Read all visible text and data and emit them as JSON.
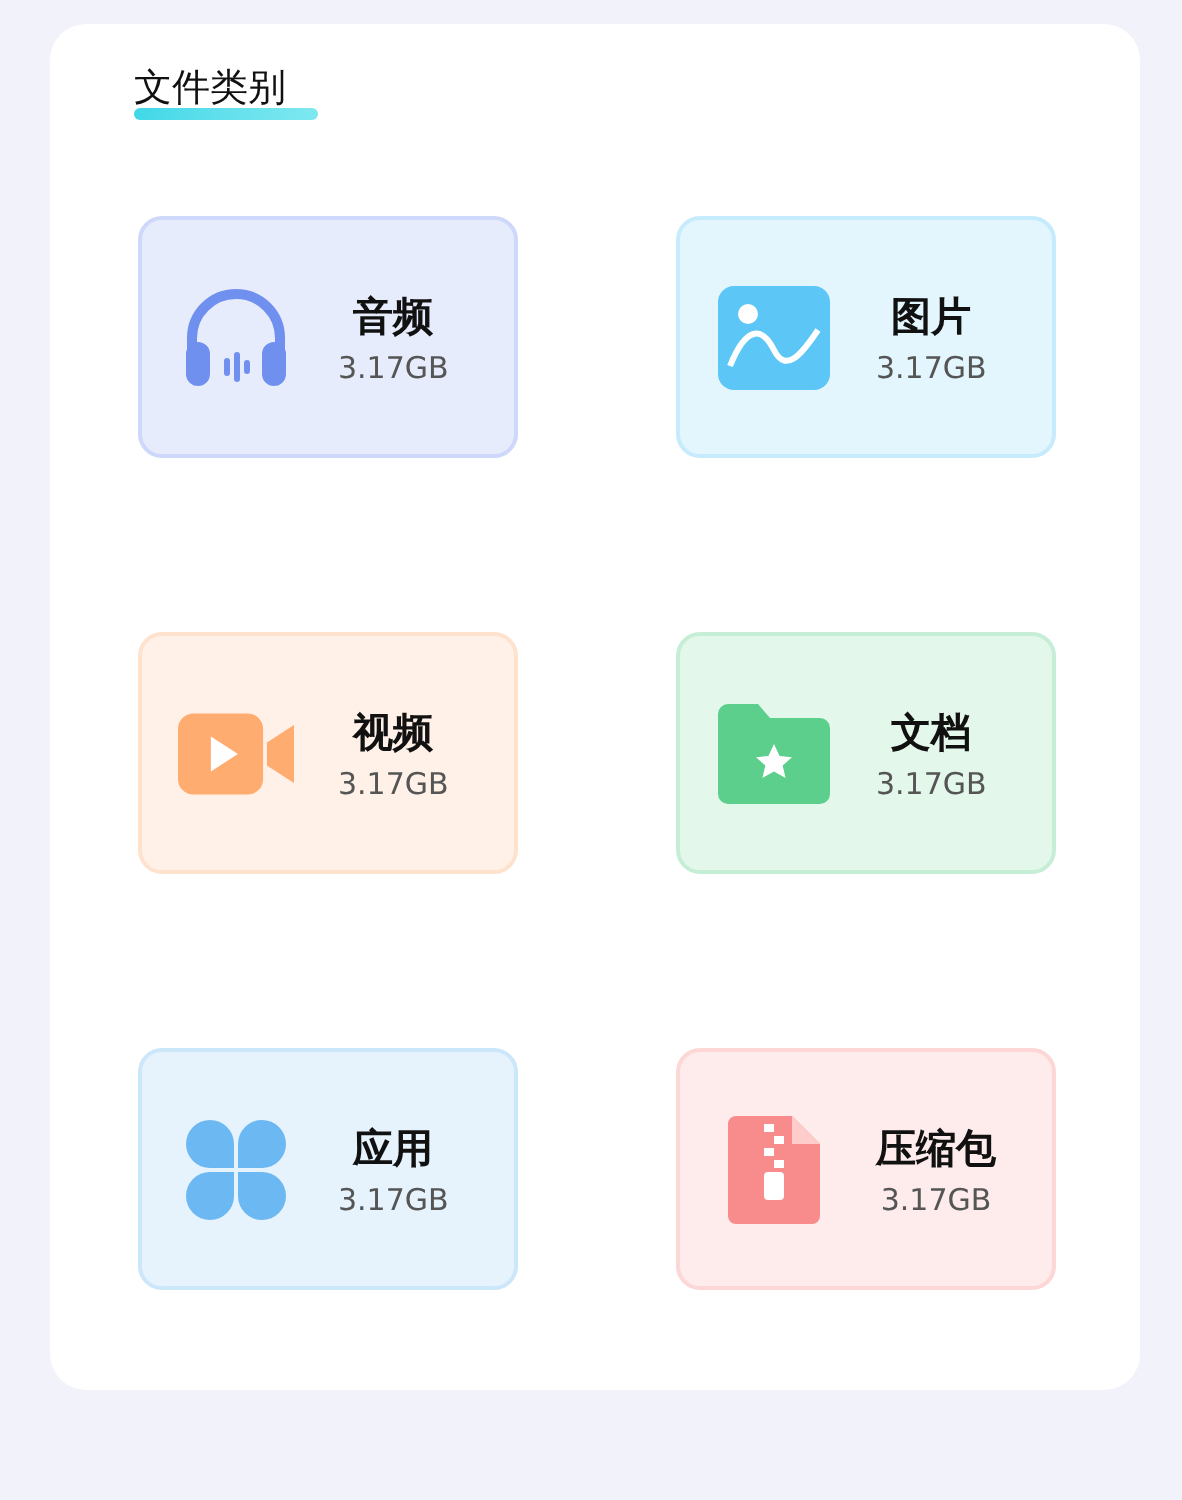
{
  "title": "文件类别",
  "categories": [
    {
      "kind": "audio",
      "label": "音频",
      "size": "3.17GB",
      "color": "#7090f0"
    },
    {
      "kind": "image",
      "label": "图片",
      "size": "3.17GB",
      "color": "#5cc6f6"
    },
    {
      "kind": "video",
      "label": "视频",
      "size": "3.17GB",
      "color": "#ffac70"
    },
    {
      "kind": "document",
      "label": "文档",
      "size": "3.17GB",
      "color": "#5ccf8c"
    },
    {
      "kind": "app",
      "label": "应用",
      "size": "3.17GB",
      "color": "#6cb8f2"
    },
    {
      "kind": "archive",
      "label": "压缩包",
      "size": "3.17GB",
      "color": "#f88b8b"
    }
  ]
}
